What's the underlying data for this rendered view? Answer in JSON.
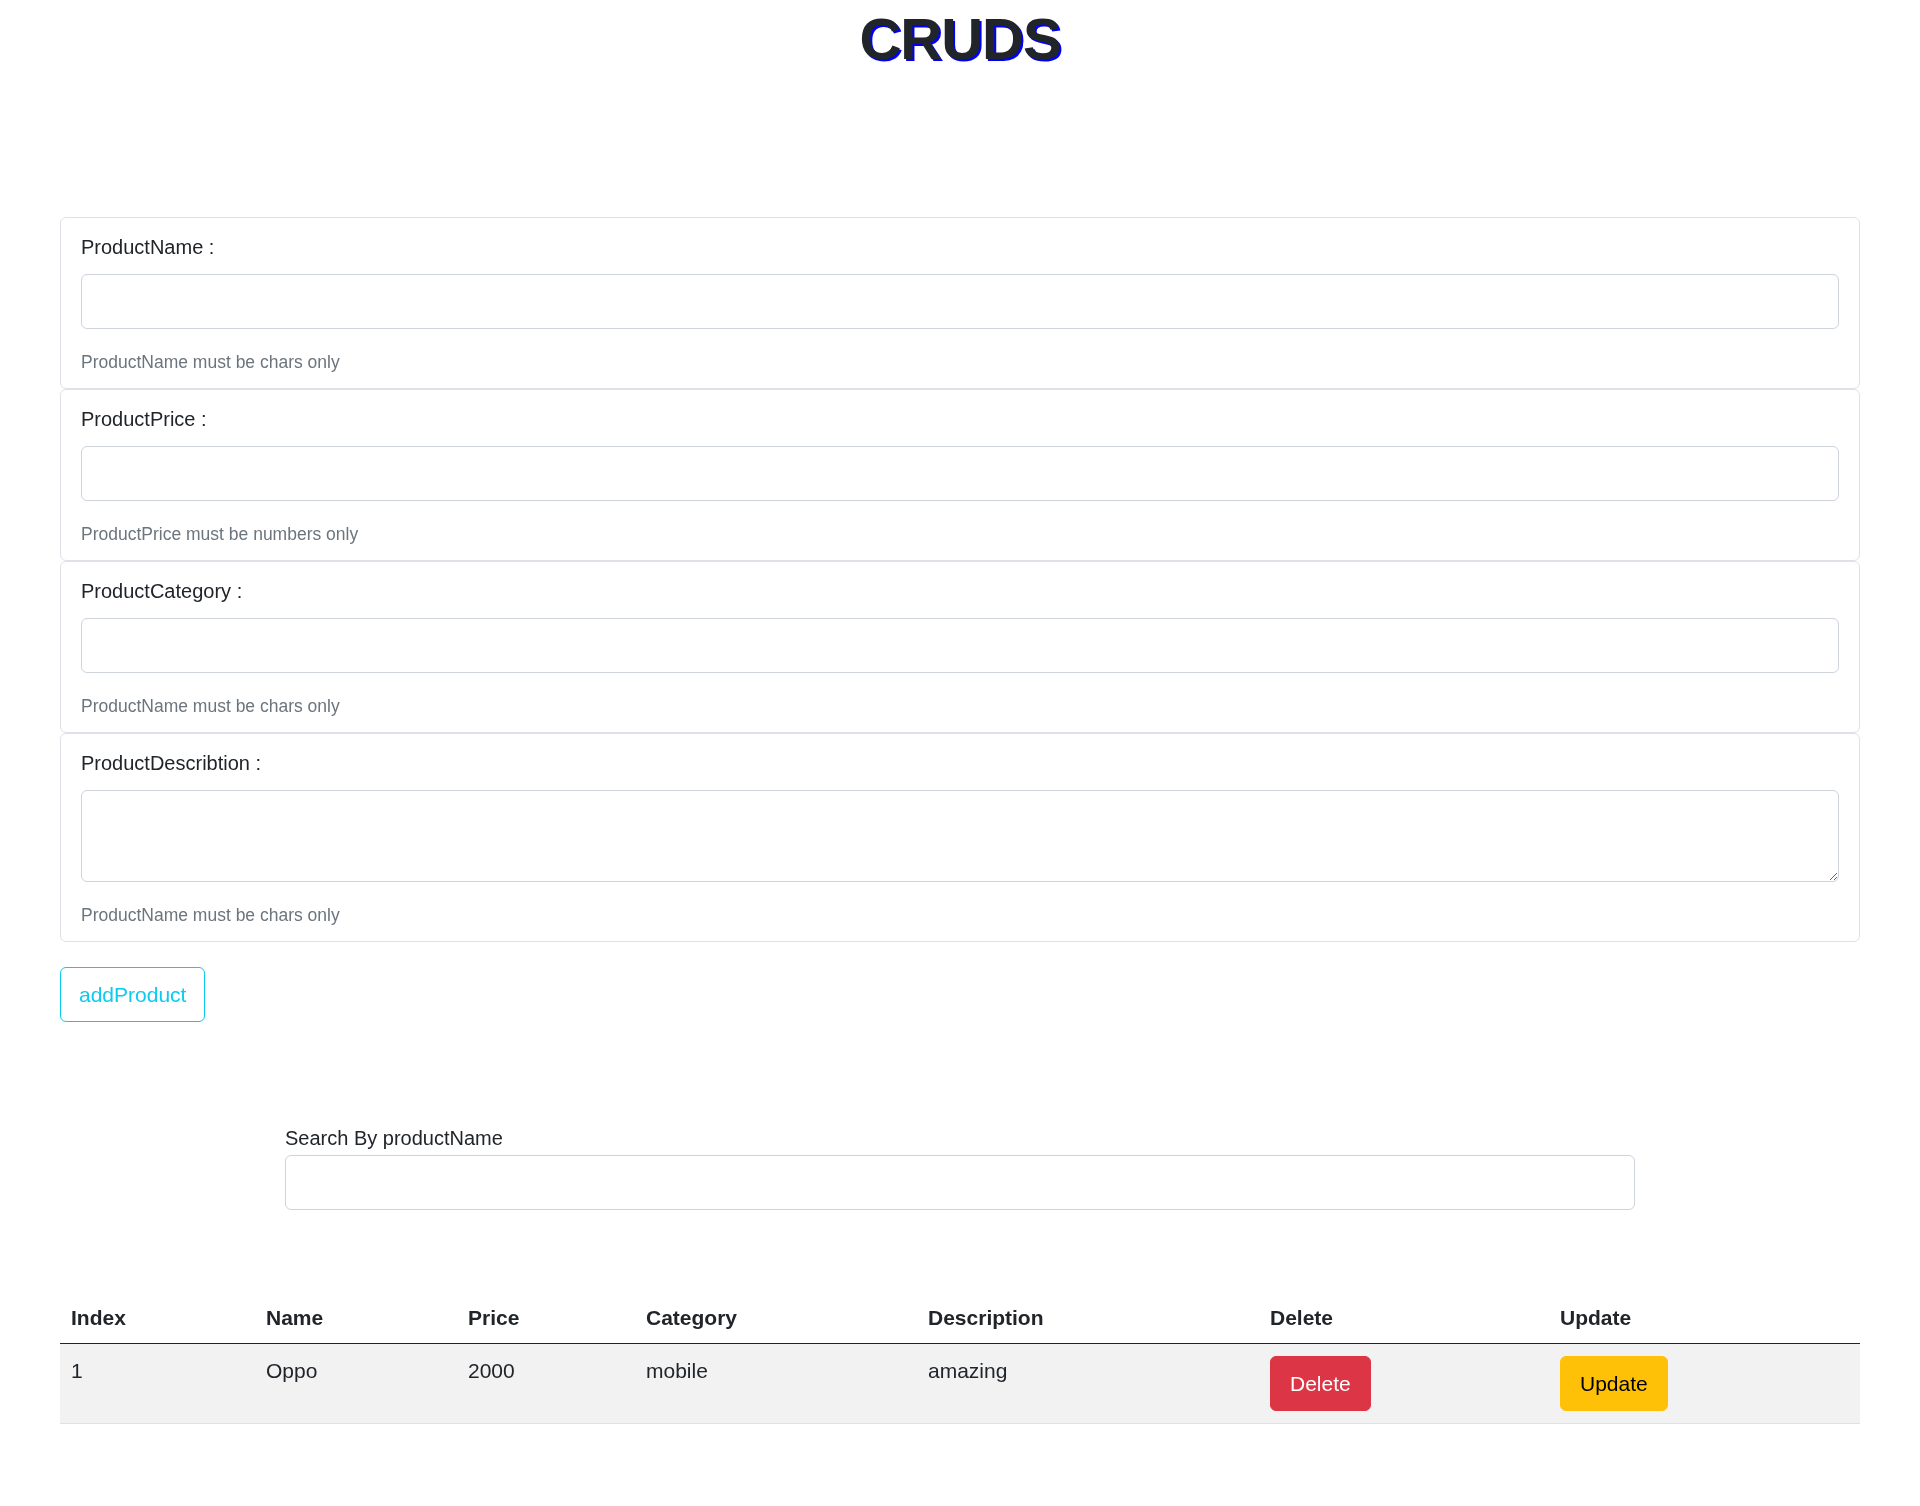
{
  "title": "CRUDS",
  "form": {
    "fields": [
      {
        "kind": "input",
        "label": "ProductName :",
        "hint": "ProductName must be chars only"
      },
      {
        "kind": "input",
        "label": "ProductPrice :",
        "hint": "ProductPrice must be numbers only"
      },
      {
        "kind": "input",
        "label": "ProductCategory :",
        "hint": "ProductName must be chars only"
      },
      {
        "kind": "textarea",
        "label": "ProductDescribtion :",
        "hint": "ProductName must be chars only"
      }
    ],
    "submit": "addProduct"
  },
  "search": {
    "label": "Search By productName"
  },
  "table": {
    "columns": [
      "Index",
      "Name",
      "Price",
      "Category",
      "Description",
      "Delete",
      "Update"
    ],
    "rows": [
      {
        "cells": [
          "1",
          "Oppo",
          "2000",
          "mobile",
          "amazing"
        ],
        "actions": [
          {
            "kind": "delete",
            "label": "Delete"
          },
          {
            "kind": "update",
            "label": "Update"
          }
        ]
      }
    ]
  }
}
